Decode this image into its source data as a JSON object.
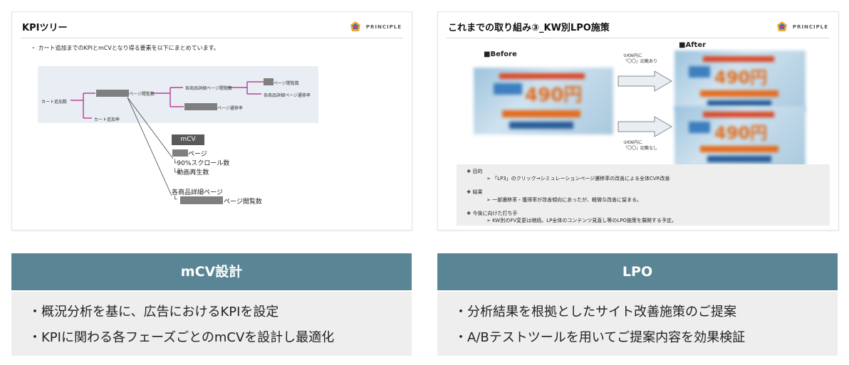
{
  "left_slide": {
    "title": "KPIツリー",
    "logo_text": "PRINCIPLE",
    "bullet": "・ カート追加までのKPIとmCVとなり得る要素を以下にまとめています。",
    "tree": {
      "root": "カート追加数",
      "rate": "カート追加率",
      "page_views": "ページ閲覧数",
      "product_detail_views": "各商品詳細ページ閲覧数",
      "page_transition_rate": "ページ遷移率",
      "page_views_2": "ページ閲覧数",
      "product_detail_transition_rate": "各商品詳細ページ遷移率"
    },
    "mcv": {
      "badge": "mCV",
      "line1": "ページ",
      "line2": "└90%スクロール数",
      "line3": "└動画再生数",
      "line4": "各商品詳細ページ",
      "line5_prefix": "└",
      "line5_suffix": "ページ閲覧数"
    }
  },
  "right_slide": {
    "title": "これまでの取り組み③_KW別LPO施策",
    "logo_text": "PRINCIPLE",
    "before_label": "■Before",
    "after_label": "■After",
    "note_top": "①KW内に\n「〇〇」記載あり",
    "note_bottom": "②KW内に\n「〇〇」記載なし",
    "banner_price": "490円",
    "summary": {
      "h1": "❖  目的",
      "b1": "➢  「LP3」のクリック→シミュレーションページ遷移率の改善による全体CVR改善",
      "h2": "❖  結果",
      "b2": "➢  一部遷移率・獲得率が改善傾向にあったが、軽微な改善に留まる。",
      "h3": "❖  今後に向けた打ち手",
      "b3": "➢  KW別のFV変更は継続。LP全体のコンテンツ見直し等のLPO施策を展開する予定。"
    }
  },
  "left_card": {
    "caption": "mCV設計",
    "items": [
      "・概況分析を基に、広告におけるKPIを設定",
      "・KPIに関わる各フェーズごとのmCVを設計し最適化"
    ]
  },
  "right_card": {
    "caption": "LPO",
    "items": [
      "・分析結果を根拠としたサイト改善施策のご提案",
      "・A/Bテストツールを用いてご提案内容を効果検証"
    ]
  },
  "colors": {
    "caption_bg": "#5a8594",
    "desc_bg": "#eeeeee",
    "tree_line": "#b0208f"
  }
}
